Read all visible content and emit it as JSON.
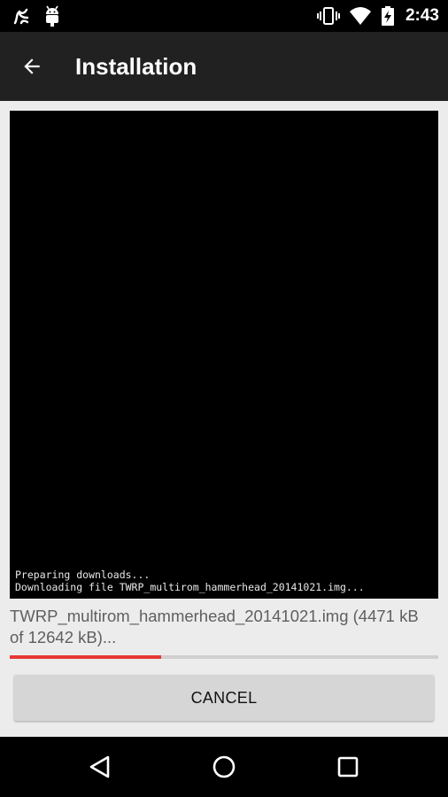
{
  "status_bar": {
    "time": "2:43",
    "left_icons": [
      "notification-icon",
      "android-debug-icon"
    ],
    "right_icons": [
      "vibrate-icon",
      "wifi-icon",
      "battery-charging-icon"
    ]
  },
  "app_bar": {
    "title": "Installation",
    "back_icon": "arrow-left-icon",
    "color": "#212121"
  },
  "terminal": {
    "lines": [
      "Preparing downloads...",
      "Downloading file TWRP_multirom_hammerhead_20141021.img..."
    ]
  },
  "progress": {
    "text": "TWRP_multirom_hammerhead_20141021.img (4471 kB of 12642 kB)...",
    "fraction": 0.354,
    "fill_color": "#e53935"
  },
  "cancel_button": {
    "label": "CANCEL"
  },
  "nav_bar": {
    "icons": [
      "nav-back-icon",
      "nav-home-icon",
      "nav-recents-icon"
    ]
  }
}
